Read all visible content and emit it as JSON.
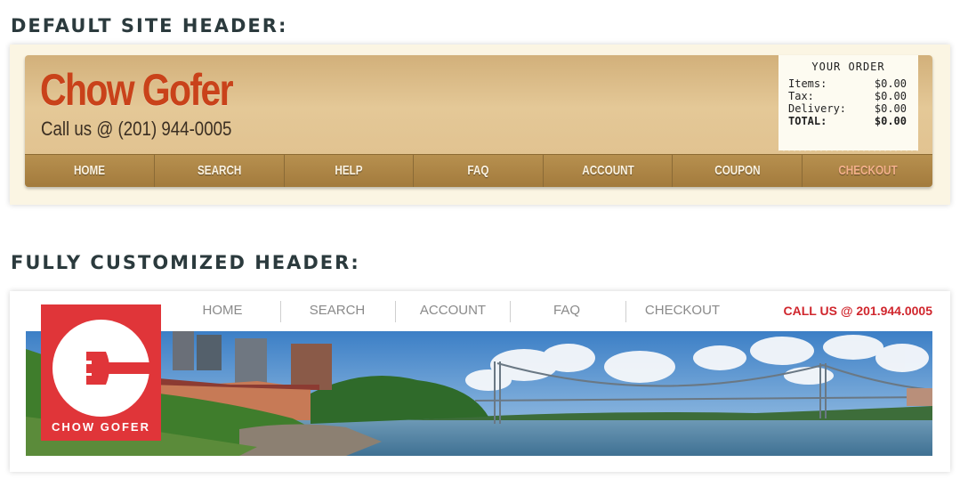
{
  "sections": {
    "default_label": "DEFAULT SITE HEADER:",
    "custom_label": "FULLY CUSTOMIZED HEADER:"
  },
  "default_header": {
    "brand": "Chow Gofer",
    "phone": "Call us @ (201) 944-0005",
    "order": {
      "title": "YOUR ORDER",
      "rows": [
        {
          "label": "Items:",
          "value": "$0.00"
        },
        {
          "label": "Tax:",
          "value": "$0.00"
        },
        {
          "label": "Delivery:",
          "value": "$0.00"
        },
        {
          "label": "TOTAL:",
          "value": "$0.00"
        }
      ]
    },
    "nav": [
      "HOME",
      "SEARCH",
      "HELP",
      "FAQ",
      "ACCOUNT",
      "COUPON",
      "CHECKOUT"
    ]
  },
  "custom_header": {
    "nav": [
      "HOME",
      "SEARCH",
      "ACCOUNT",
      "FAQ",
      "CHECKOUT"
    ],
    "call": "CALL US @ 201.944.0005",
    "logo_text": "CHOW GOFER",
    "logo_icon": "fork-icon"
  },
  "colors": {
    "brand_red": "#c9421a",
    "logo_red": "#e03539",
    "call_red": "#d0262d",
    "nav_tan": "#a27a3c",
    "checkout_accent": "#f3b08a"
  }
}
